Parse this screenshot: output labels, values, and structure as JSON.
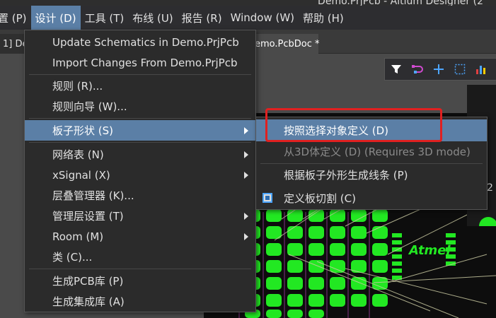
{
  "window": {
    "title": "Demo.PrjPcb - Altium Designer (2"
  },
  "menubar": {
    "items": [
      {
        "label": "置 (P)"
      },
      {
        "label": "设计 (D)"
      },
      {
        "label": "工具 (T)"
      },
      {
        "label": "布线 (U)"
      },
      {
        "label": "报告 (R)"
      },
      {
        "label": "Window (W)"
      },
      {
        "label": "帮助 (H)"
      }
    ]
  },
  "tabs": {
    "left_label": "1] De",
    "right_label": "emo.PcbDoc *"
  },
  "toolbar": {
    "icons": [
      "filter-icon",
      "route-icon",
      "add-icon",
      "select-rect-icon",
      "chart-icon"
    ]
  },
  "design_menu": {
    "items": [
      {
        "label": "Update Schematics in Demo.PrjPcb"
      },
      {
        "label": "Import Changes From Demo.PrjPcb"
      },
      {
        "label": "规则 (R)..."
      },
      {
        "label": "规则向导 (W)..."
      },
      {
        "label": "板子形状 (S)"
      },
      {
        "label": "网络表 (N)"
      },
      {
        "label": "xSignal (X)"
      },
      {
        "label": "层叠管理器 (K)..."
      },
      {
        "label": "管理层设置 (T)"
      },
      {
        "label": "Room (M)"
      },
      {
        "label": "类 (C)..."
      },
      {
        "label": "生成PCB库 (P)"
      },
      {
        "label": "生成集成库 (A)"
      }
    ]
  },
  "board_shape_submenu": {
    "items": [
      {
        "label": "按照选择对象定义 (D)"
      },
      {
        "label": "从3D体定义 (D) (Requires 3D mode)"
      },
      {
        "label": "根据板子外形生成线条 (P)"
      },
      {
        "label": "定义板切割 (C)"
      }
    ]
  },
  "colors": {
    "highlight": "#5b7fa6",
    "menu_bg": "#2b2b2b",
    "annotation_red": "#e02020",
    "pcb_pad": "#22e822"
  }
}
